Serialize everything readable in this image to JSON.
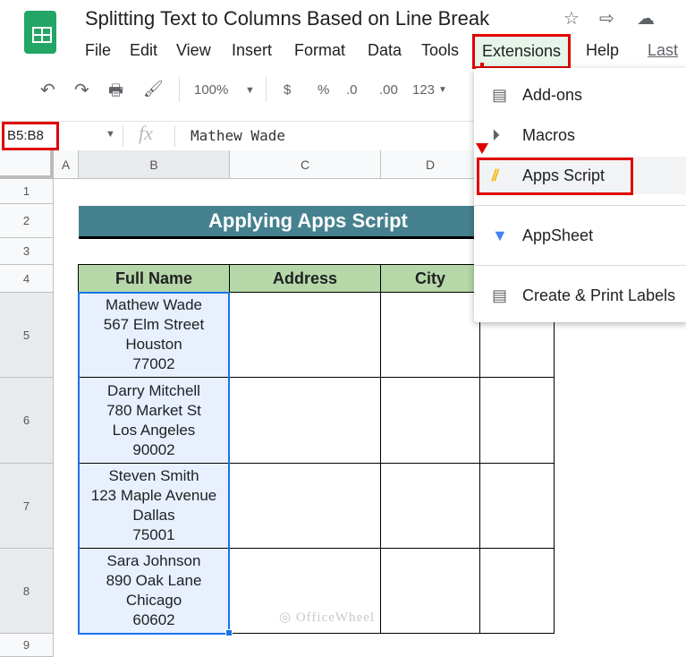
{
  "app": {
    "title": "Splitting Text to Columns Based on Line Break",
    "icons": [
      "star-icon",
      "move-to-folder-icon",
      "cloud-saved-icon"
    ]
  },
  "menu": [
    "File",
    "Edit",
    "View",
    "Insert",
    "Format",
    "Data",
    "Tools",
    "Extensions",
    "Help"
  ],
  "last_edit": "Last",
  "toolbar": {
    "zoom": "100%",
    "currency": "$",
    "percent": "%",
    "dec_decrease": ".0",
    "dec_increase": ".00",
    "format": "123"
  },
  "formula_bar": {
    "name_box": "B5:B8",
    "fx": "fx",
    "value": "Mathew Wade"
  },
  "columns": [
    "A",
    "B",
    "C",
    "D"
  ],
  "rows": [
    "1",
    "2",
    "3",
    "4",
    "5",
    "6",
    "7",
    "8",
    "9"
  ],
  "sheet": {
    "banner": "Applying Apps Script",
    "headers": [
      "Full Name",
      "Address",
      "City"
    ],
    "names": [
      [
        "Mathew Wade",
        "567 Elm Street",
        "Houston",
        "77002"
      ],
      [
        "Darry Mitchell",
        "780 Market St",
        "Los Angeles",
        "90002"
      ],
      [
        "Steven Smith",
        "123 Maple Avenue",
        "Dallas",
        "75001"
      ],
      [
        "Sara Johnson",
        "890 Oak Lane",
        "Chicago",
        "60602"
      ]
    ]
  },
  "extensions_menu": [
    {
      "label": "Add-ons",
      "icon": "add-ons-icon"
    },
    {
      "label": "Macros",
      "icon": "macros-play-icon"
    },
    {
      "label": "Apps Script",
      "icon": "apps-script-icon",
      "highlighted": true
    },
    {
      "label": "AppSheet",
      "icon": "appsheet-icon"
    },
    {
      "label": "Create & Print Labels",
      "icon": "labels-icon"
    }
  ],
  "watermark": "OfficeWheel",
  "colors": {
    "banner": "#45818e",
    "header": "#b6d7a8",
    "highlight": "#e00000",
    "selection": "#e8f0fe"
  }
}
